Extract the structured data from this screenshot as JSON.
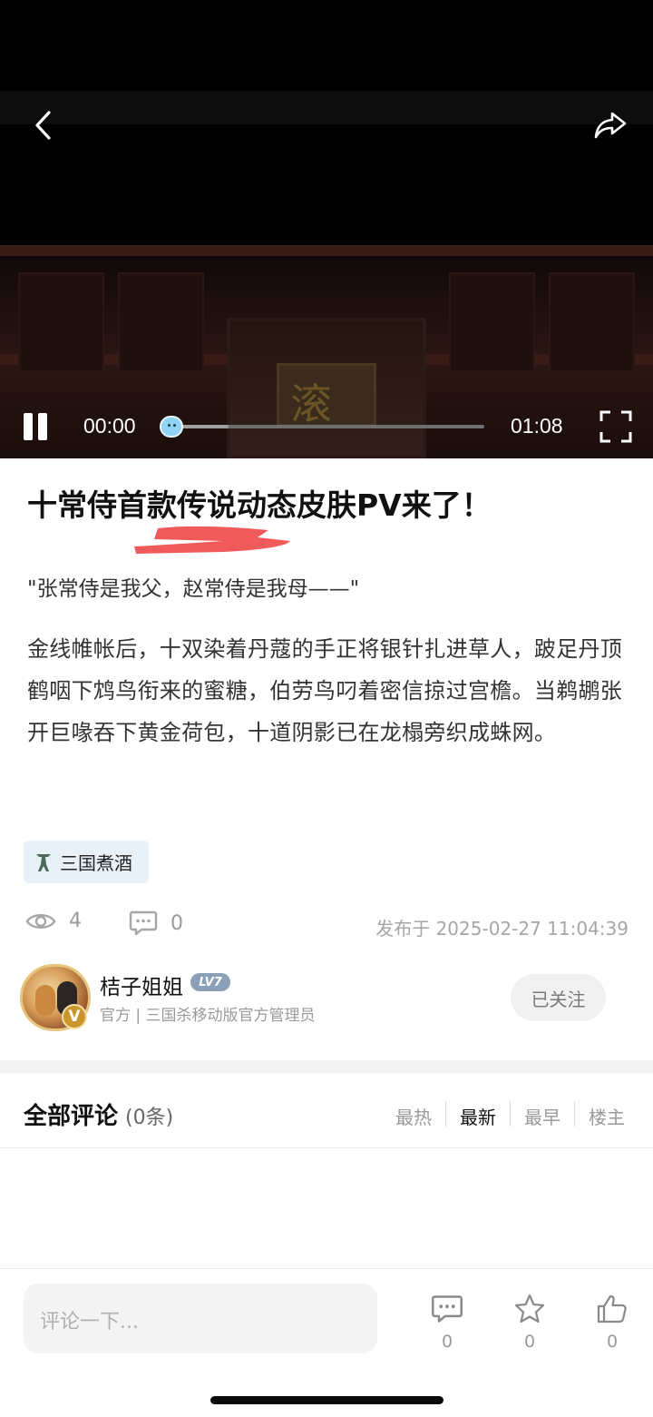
{
  "video": {
    "plaque_text": "滚",
    "current_time": "00:00",
    "total_time": "01:08",
    "progress_fraction": 0.0,
    "buffered_fraction": 0.2
  },
  "post": {
    "title": "十常侍首款传说动态皮肤PV来了！",
    "quote": "\"张常侍是我父，赵常侍是我母——\"",
    "body": "金线帷帐后，十双染着丹蔻的手正将银针扎进草人，跛足丹顶鹤咽下鸩鸟衔来的蜜糖，伯劳鸟叼着密信掠过宫檐。当鹈鹕张开巨喙吞下黄金荷包，十道阴影已在龙榻旁织成蛛网。",
    "tag": "三国煮酒",
    "views": "4",
    "comments": "0",
    "published": "发布于 2025-02-27 11:04:39"
  },
  "author": {
    "name": "桔子姐姐",
    "level": "LV7",
    "verified_badge": "V",
    "role": "官方 | 三国杀移动版官方管理员",
    "follow_label": "已关注"
  },
  "comments_section": {
    "title": "全部评论",
    "count": "(0条)",
    "sort_options": [
      "最热",
      "最新",
      "最早",
      "楼主"
    ],
    "active_sort": "最新"
  },
  "bottom_bar": {
    "input_placeholder": "评论一下...",
    "comment_count": "0",
    "favorite_count": "0",
    "like_count": "0"
  },
  "colors": {
    "redaction": "#f05a5a",
    "progress_thumb": "#8fd3f5",
    "tag_bg": "#e9f1f8"
  }
}
